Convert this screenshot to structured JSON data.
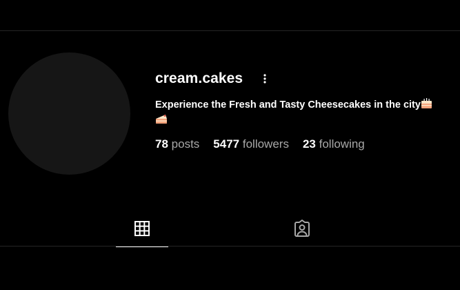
{
  "profile": {
    "username": "cream.cakes",
    "bio": "Experience the Fresh and Tasty Cheesecakes in the city",
    "bio_emojis": [
      "birthday-cake-icon",
      "cake-slice-icon"
    ],
    "more_options_icon": "more-vertical-icon"
  },
  "stats": {
    "posts_count": "78",
    "posts_label": "posts",
    "followers_count": "5477",
    "followers_label": "followers",
    "following_count": "23",
    "following_label": "following"
  },
  "tabs": [
    {
      "icon": "grid-icon",
      "active": true
    },
    {
      "icon": "tagged-user-icon",
      "active": false
    }
  ],
  "colors": {
    "background": "#000000",
    "avatar": "#161616",
    "divider": "#262626",
    "muted_text": "#a8a8a8",
    "cake_frosting": "#f4a37c",
    "cake_cream": "#fde6c8"
  }
}
